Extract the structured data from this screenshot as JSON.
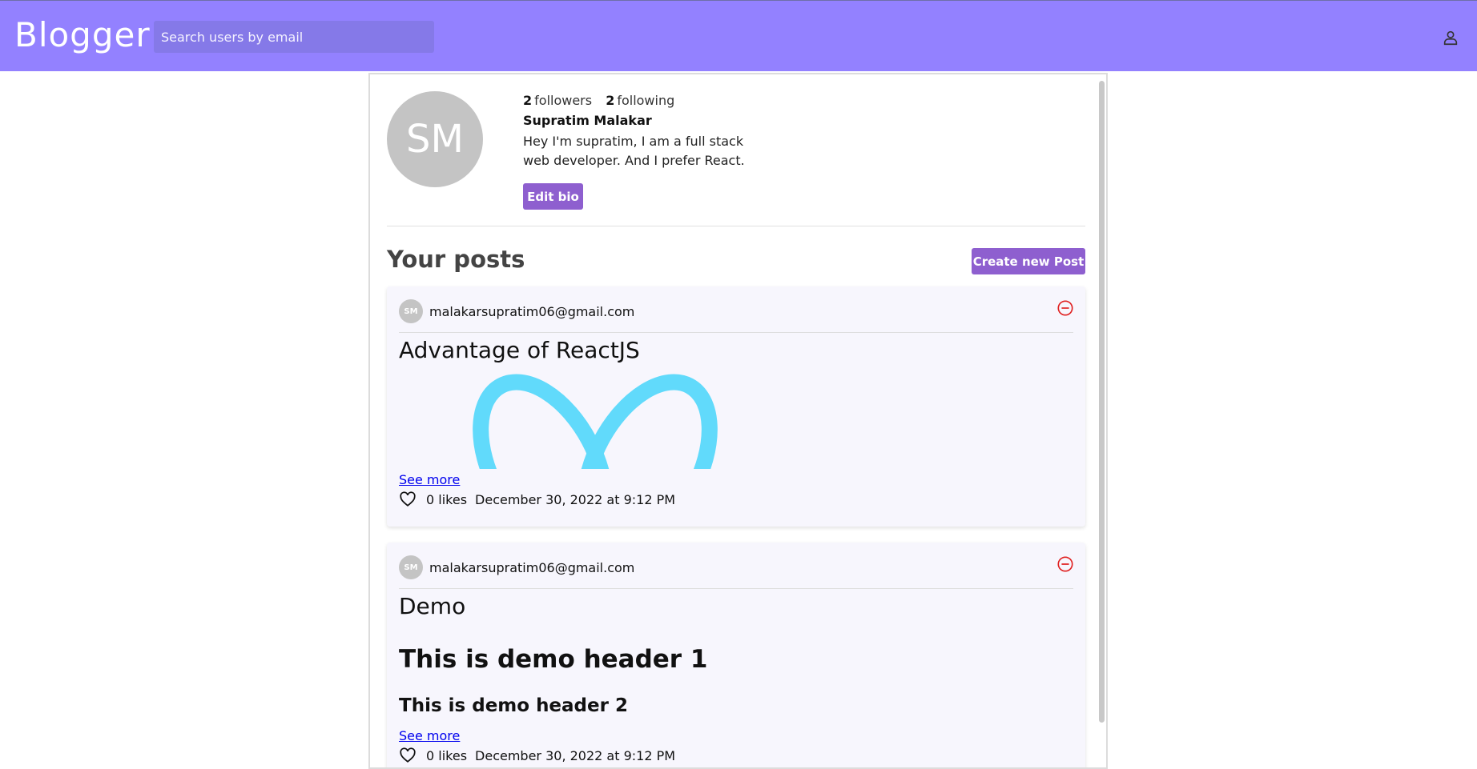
{
  "header": {
    "brand": "Blogger",
    "search_placeholder": "Search users by email",
    "bg_color": "#9381ff"
  },
  "profile": {
    "avatar_initials": "SM",
    "followers_count": "2",
    "followers_label": "followers",
    "following_count": "2",
    "following_label": "following",
    "name": "Supratim Malakar",
    "bio": "Hey I'm supratim, I am a full stack web developer. And I prefer React.",
    "edit_bio_label": "Edit bio"
  },
  "posts_section": {
    "title": "Your posts",
    "create_label": "Create new Post"
  },
  "posts": [
    {
      "avatar_initials": "SM",
      "author_email": "malakarsupratim06@gmail.com",
      "title": "Advantage of ReactJS",
      "see_more": "See more",
      "likes": "0 likes",
      "date": "December 30, 2022 at 9:12 PM"
    },
    {
      "avatar_initials": "SM",
      "author_email": "malakarsupratim06@gmail.com",
      "title": "Demo",
      "header1": "This is demo header 1",
      "header2": "This is demo header 2",
      "see_more": "See more",
      "likes": "0 likes",
      "date": "December 30, 2022 at 9:12 PM"
    }
  ],
  "icons": {
    "user": "user-icon",
    "delete": "minus-circle-icon",
    "like": "heart-icon"
  },
  "colors": {
    "accent": "#8e5fcf",
    "delete": "#e02020",
    "react_logo": "#61dafb"
  }
}
